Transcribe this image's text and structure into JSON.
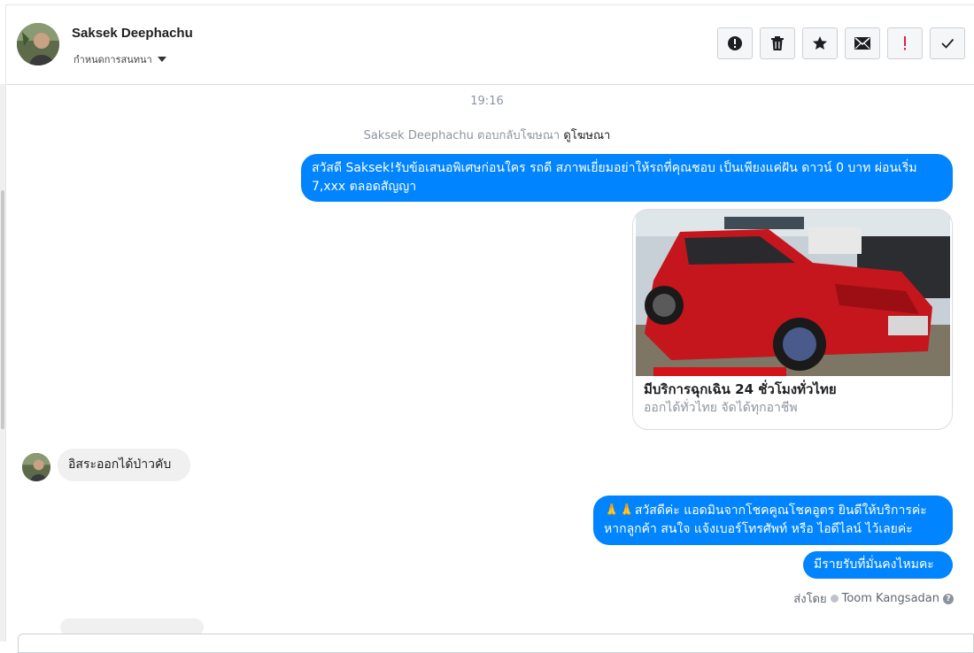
{
  "header": {
    "contact_name": "Saksek Deephachu",
    "assign_label": "กำหนดการสนทนา",
    "toolbar": [
      {
        "name": "report-button",
        "icon": "exclamation-circle-icon"
      },
      {
        "name": "delete-button",
        "icon": "trash-icon"
      },
      {
        "name": "star-button",
        "icon": "star-icon"
      },
      {
        "name": "mark-unread-button",
        "icon": "envelope-icon"
      },
      {
        "name": "follow-up-button",
        "icon": "red-exclamation-icon"
      },
      {
        "name": "mark-done-button",
        "icon": "checkmark-icon"
      }
    ]
  },
  "conversation": {
    "time": "19:16",
    "system_text": "Saksek Deephachu ตอบกลับโฆษณา",
    "system_link": "ดูโฆษณา",
    "outgoing_1": "สวัสดี Saksek!รับข้อเสนอพิเศษก่อนใคร รถดี สภาพเยี่ยมอย่าให้รถที่คุณชอบ เป็นเพียงแค่ฝัน ดาวน์ 0 บาท ผ่อนเริ่ม 7,xxx ตลอดสัญญา",
    "ad_card": {
      "title": "มีบริการฉุกเฉิน 24 ชั่วโมงทั่วไทย",
      "subtitle": "ออกได้ทั่วไทย จัดได้ทุกอาชีพ",
      "image_icon": "red-pickup-truck-photo"
    },
    "incoming_1": "อิสระออกได้ป่าวคับ",
    "outgoing_2": "🙏🙏สวัสดีค่ะ แอดมินจากโชคคูณโชคอูตร ยินดีให้บริการค่ะ หากลูกค้า สนใจ แจ้งเบอร์โทรศัพท์ หรือ ไอดีไลน์  ไว้เลยค่ะ",
    "outgoing_3": "มีรายรับที่มั่นคงไหมคะ",
    "sent_by_label": "ส่งโดย",
    "sent_by_name": "Toom Kangsadan"
  },
  "colors": {
    "outgoing_bubble": "#0084ff",
    "incoming_bubble": "#f1f0f0",
    "follow_up_icon": "#e41e3f"
  }
}
